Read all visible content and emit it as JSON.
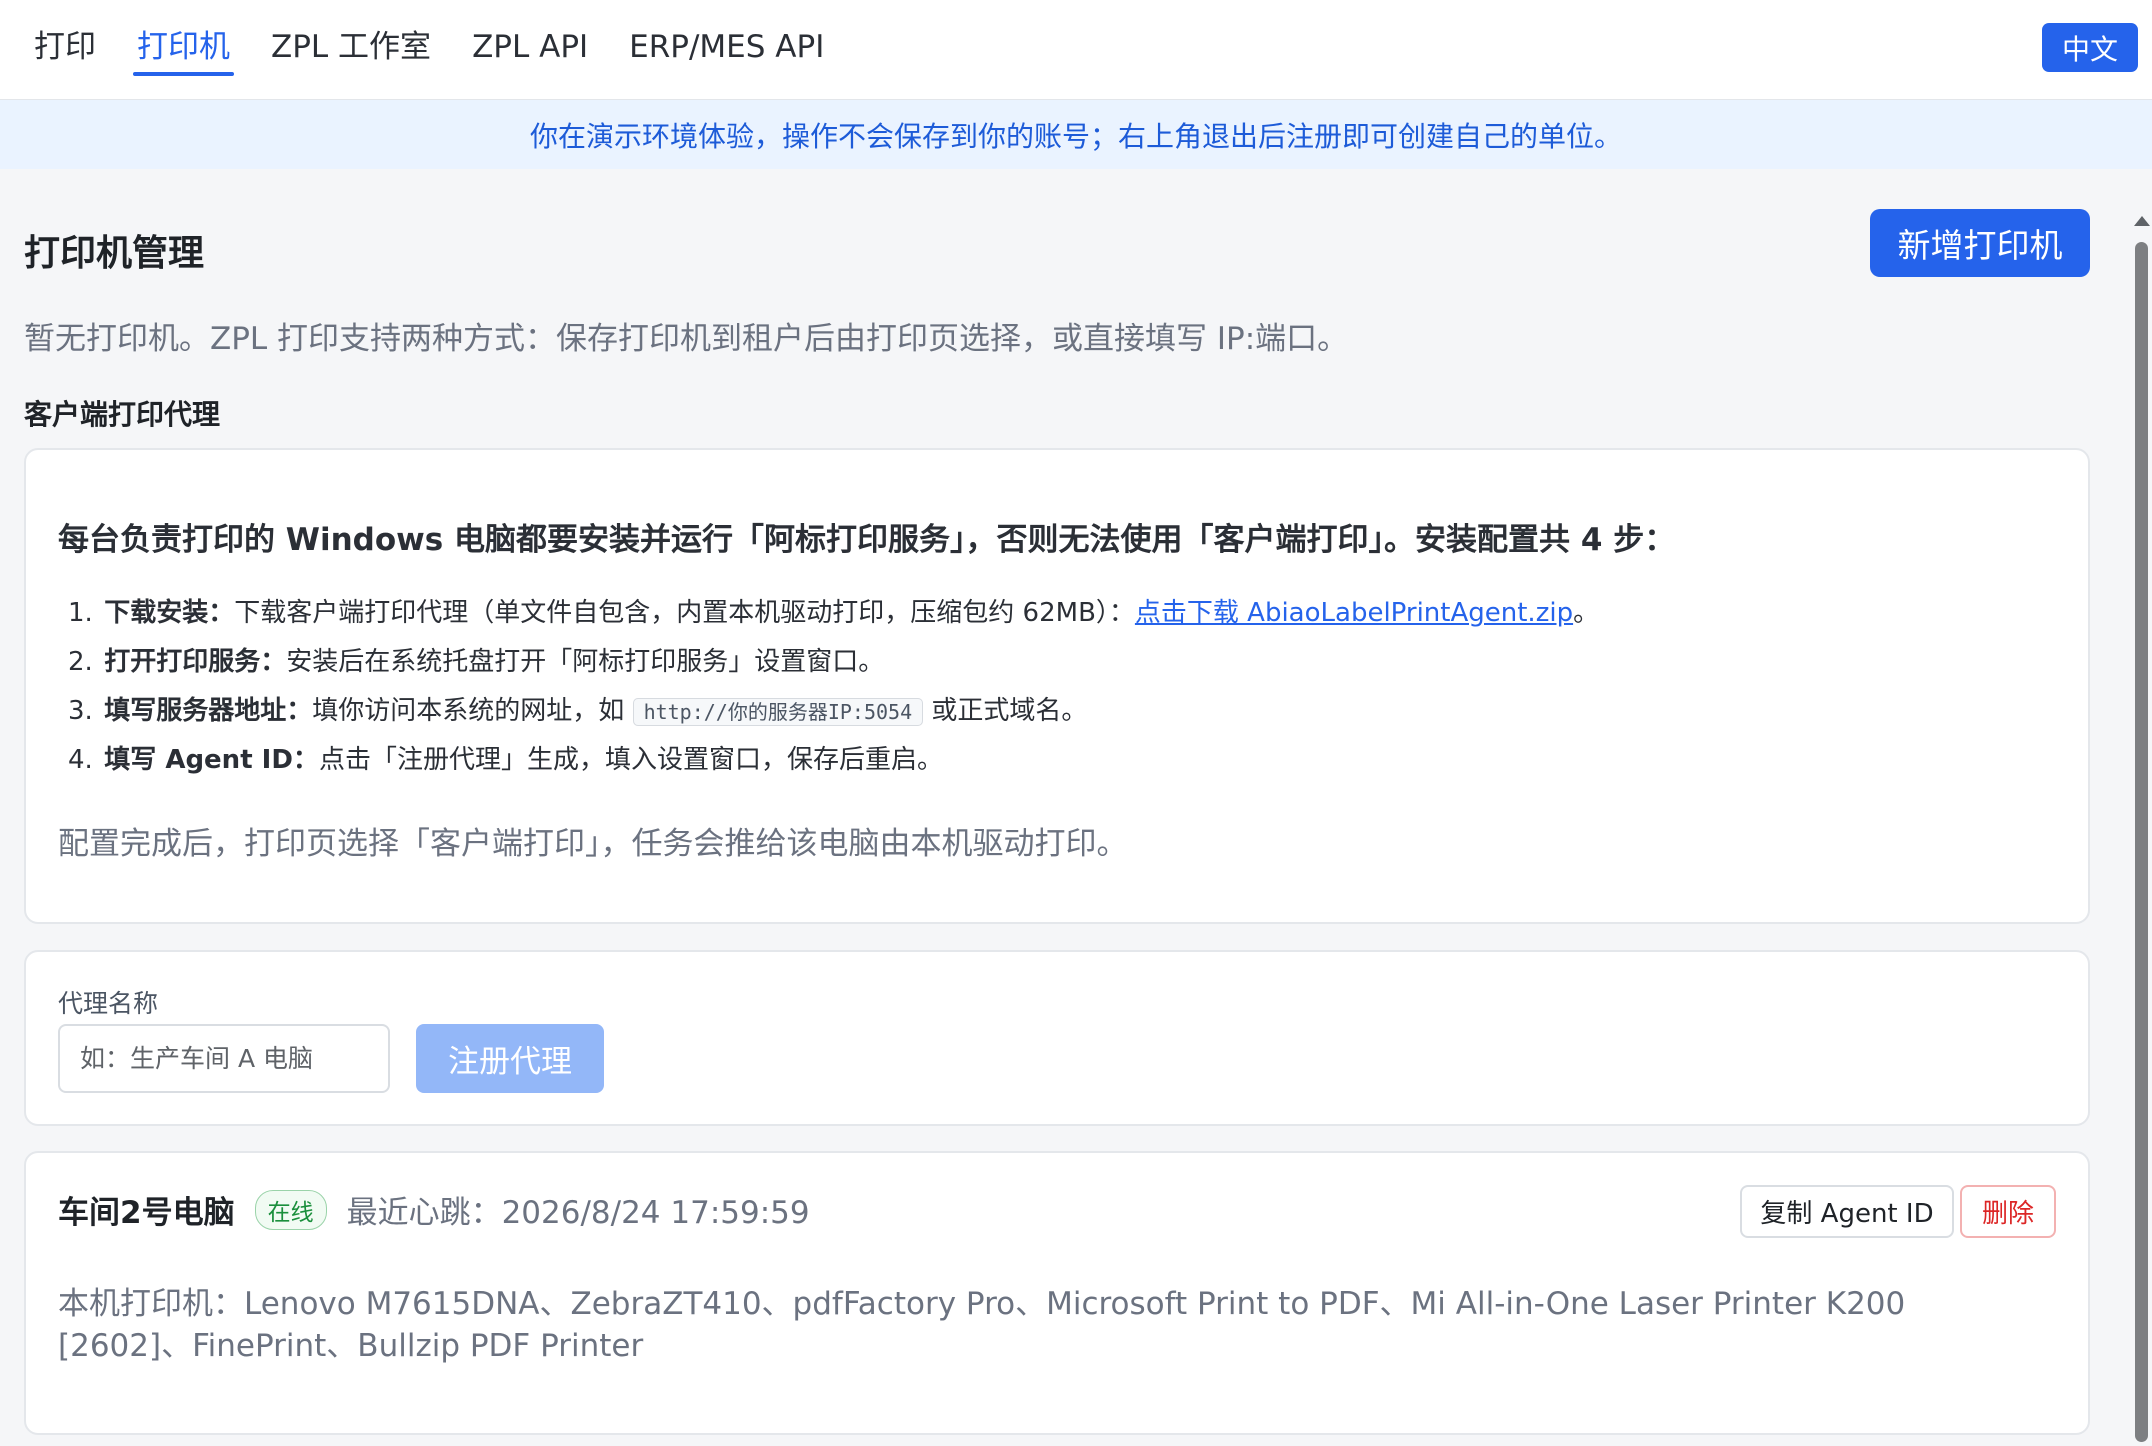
{
  "nav": {
    "tabs": [
      {
        "label": "打印",
        "active": false
      },
      {
        "label": "打印机",
        "active": true
      },
      {
        "label": "ZPL 工作室",
        "active": false
      },
      {
        "label": "ZPL API",
        "active": false
      },
      {
        "label": "ERP/MES API",
        "active": false
      }
    ],
    "language": "中文"
  },
  "banner": "你在演示环境体验，操作不会保存到你的账号；右上角退出后注册即可创建自己的单位。",
  "page": {
    "title": "打印机管理",
    "add_button": "新增打印机",
    "empty_desc": "暂无打印机。ZPL 打印支持两种方式：保存打印机到租户后由打印页选择，或直接填写 IP:端口。"
  },
  "client_agent": {
    "section_title": "客户端打印代理",
    "heading": "每台负责打印的 Windows 电脑都要安装并运行「阿标打印服务」，否则无法使用「客户端打印」。安装配置共 4 步：",
    "steps": [
      {
        "num": "1.",
        "title": "下载安装：",
        "text": "下载客户端打印代理（单文件自包含，内置本机驱动打印，压缩包约 62MB）：",
        "link": "点击下载 AbiaoLabelPrintAgent.zip",
        "suffix": "。"
      },
      {
        "num": "2.",
        "title": "打开打印服务：",
        "text": "安装后在系统托盘打开「阿标打印服务」设置窗口。"
      },
      {
        "num": "3.",
        "title": "填写服务器地址：",
        "text": "填你访问本系统的网址，如",
        "code": "http://你的服务器IP:5054",
        "suffix": "或正式域名。"
      },
      {
        "num": "4.",
        "title": "填写 Agent ID：",
        "text": "点击「注册代理」生成，填入设置窗口，保存后重启。"
      }
    ],
    "footer": "配置完成后，打印页选择「客户端打印」，任务会推给该电脑由本机驱动打印。"
  },
  "register": {
    "label": "代理名称",
    "placeholder": "如：生产车间 A 电脑",
    "value": "",
    "button": "注册代理"
  },
  "agent": {
    "name": "车间2号电脑",
    "status": "在线",
    "heartbeat": "最近心跳：2026/8/24 17:59:59",
    "copy_button": "复制 Agent ID",
    "delete_button": "删除",
    "printers": "本机打印机：Lenovo M7615DNA、ZebraZT410、pdfFactory Pro、Microsoft Print to PDF、Mi All-in-One Laser Printer K200 [2602]、FinePrint、Bullzip PDF Printer"
  },
  "colors": {
    "primary": "#2563eb",
    "primary_disabled": "#93b7f8",
    "banner_bg": "#eaf3ff",
    "online_green": "#1a8f3c",
    "danger": "#dc2626"
  }
}
